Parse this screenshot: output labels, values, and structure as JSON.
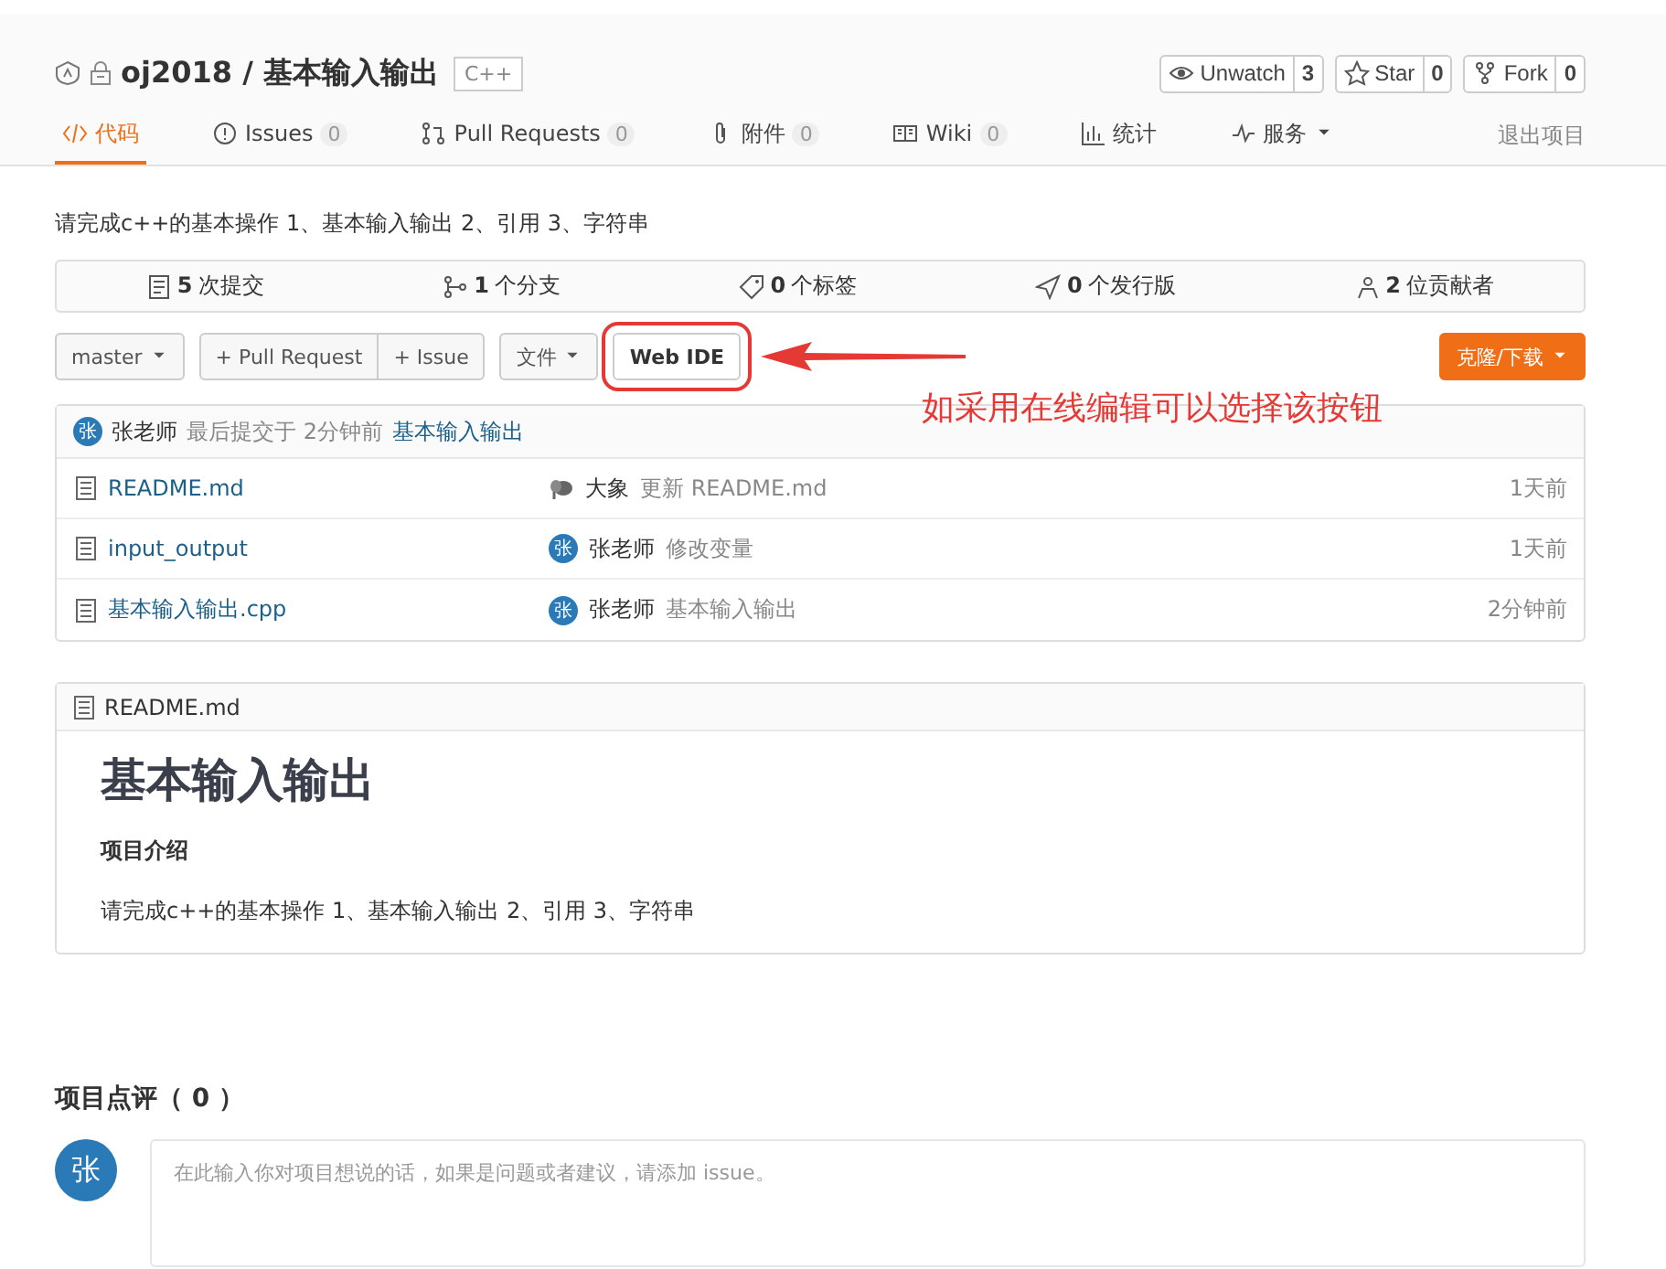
{
  "header": {
    "owner_name": "oj2018",
    "separator": "/",
    "repo_name": "基本输入输出",
    "language": "C++",
    "actions": [
      {
        "label": "Unwatch",
        "count": "3"
      },
      {
        "label": "Star",
        "count": "0"
      },
      {
        "label": "Fork",
        "count": "0"
      }
    ]
  },
  "tabs": [
    {
      "label": "代码",
      "selected": true
    },
    {
      "label": "Issues",
      "count": "0",
      "selected": false
    },
    {
      "label": "Pull Requests",
      "count": "0",
      "selected": false
    },
    {
      "label": "附件",
      "count": "0",
      "selected": false
    },
    {
      "label": "Wiki",
      "count": "0",
      "selected": false
    },
    {
      "label": "统计",
      "selected": false
    },
    {
      "label": "服务",
      "selected": false,
      "dropdown": true
    }
  ],
  "exit_link": "退出项目",
  "description": "请完成c++的基本操作 1、基本输入输出 2、引用 3、字符串",
  "stats": [
    {
      "count": "5",
      "label": "次提交"
    },
    {
      "count": "1",
      "label": "个分支"
    },
    {
      "count": "0",
      "label": "个标签"
    },
    {
      "count": "0",
      "label": "个发行版"
    },
    {
      "count": "2",
      "label": "位贡献者"
    }
  ],
  "toolbar": {
    "branch": "master",
    "pull_request": "+ Pull Request",
    "issue": "+ Issue",
    "file_menu": "文件",
    "web_ide": "Web IDE",
    "clone": "克隆/下载"
  },
  "annotation": {
    "text": "如采用在线编辑可以选择该按钮"
  },
  "last_commit": {
    "avatar": "张",
    "author": "张老师",
    "info": "最后提交于 2分钟前",
    "message": "基本输入输出"
  },
  "files": [
    {
      "name": "README.md",
      "kind": "icon",
      "author": "大象",
      "message": "更新 README.md",
      "time": "1天前"
    },
    {
      "name": "input_output",
      "kind": "letter",
      "avatar": "张",
      "author": "张老师",
      "message": "修改变量",
      "time": "1天前"
    },
    {
      "name": "基本输入输出.cpp",
      "kind": "letter",
      "avatar": "张",
      "author": "张老师",
      "message": "基本输入输出",
      "time": "2分钟前"
    }
  ],
  "readme": {
    "file": "README.md",
    "title": "基本输入输出",
    "subtitle": "项目介绍",
    "body": "请完成c++的基本操作 1、基本输入输出 2、引用 3、字符串"
  },
  "comments": {
    "heading": "项目点评（ 0 ）",
    "avatar": "张",
    "placeholder": "在此输入你对项目想说的话，如果是问题或者建议，请添加 issue。"
  }
}
